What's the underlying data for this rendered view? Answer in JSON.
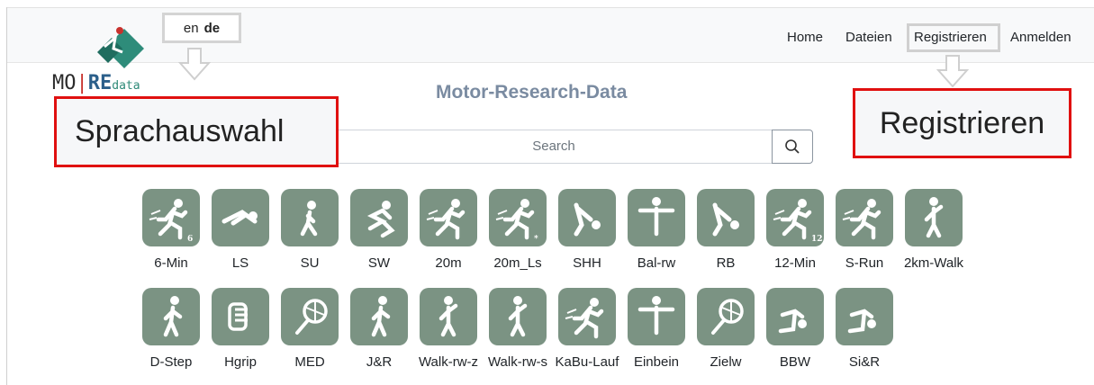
{
  "nav": {
    "items": [
      "Home",
      "Dateien",
      "Registrieren",
      "Anmelden"
    ]
  },
  "lang": {
    "en": "en",
    "de": "de"
  },
  "logo": {
    "mo": "MO",
    "re": "RE",
    "data": "data"
  },
  "site_title": "Motor-Research-Data",
  "search": {
    "placeholder": "Search"
  },
  "callouts": {
    "language": "Sprachauswahl",
    "register": "Registrieren"
  },
  "tests_row1": [
    "6-Min",
    "LS",
    "SU",
    "SW",
    "20m",
    "20m_Ls",
    "SHH",
    "Bal-rw",
    "RB",
    "12-Min",
    "S-Run",
    "2km-Walk"
  ],
  "tests_row2": [
    "D-Step",
    "Hgrip",
    "MED",
    "J&R",
    "Walk-rw-z",
    "Walk-rw-s",
    "KaBu-Lauf",
    "Einbein",
    "Zielw",
    "BBW",
    "Si&R"
  ],
  "tile_overlays_row1": [
    "6",
    "",
    "",
    "",
    "",
    "*",
    "",
    "",
    "",
    "12",
    "",
    ""
  ],
  "colors": {
    "tile": "#7b9383",
    "callout_border": "#e01010",
    "title": "#7a8ba1"
  }
}
